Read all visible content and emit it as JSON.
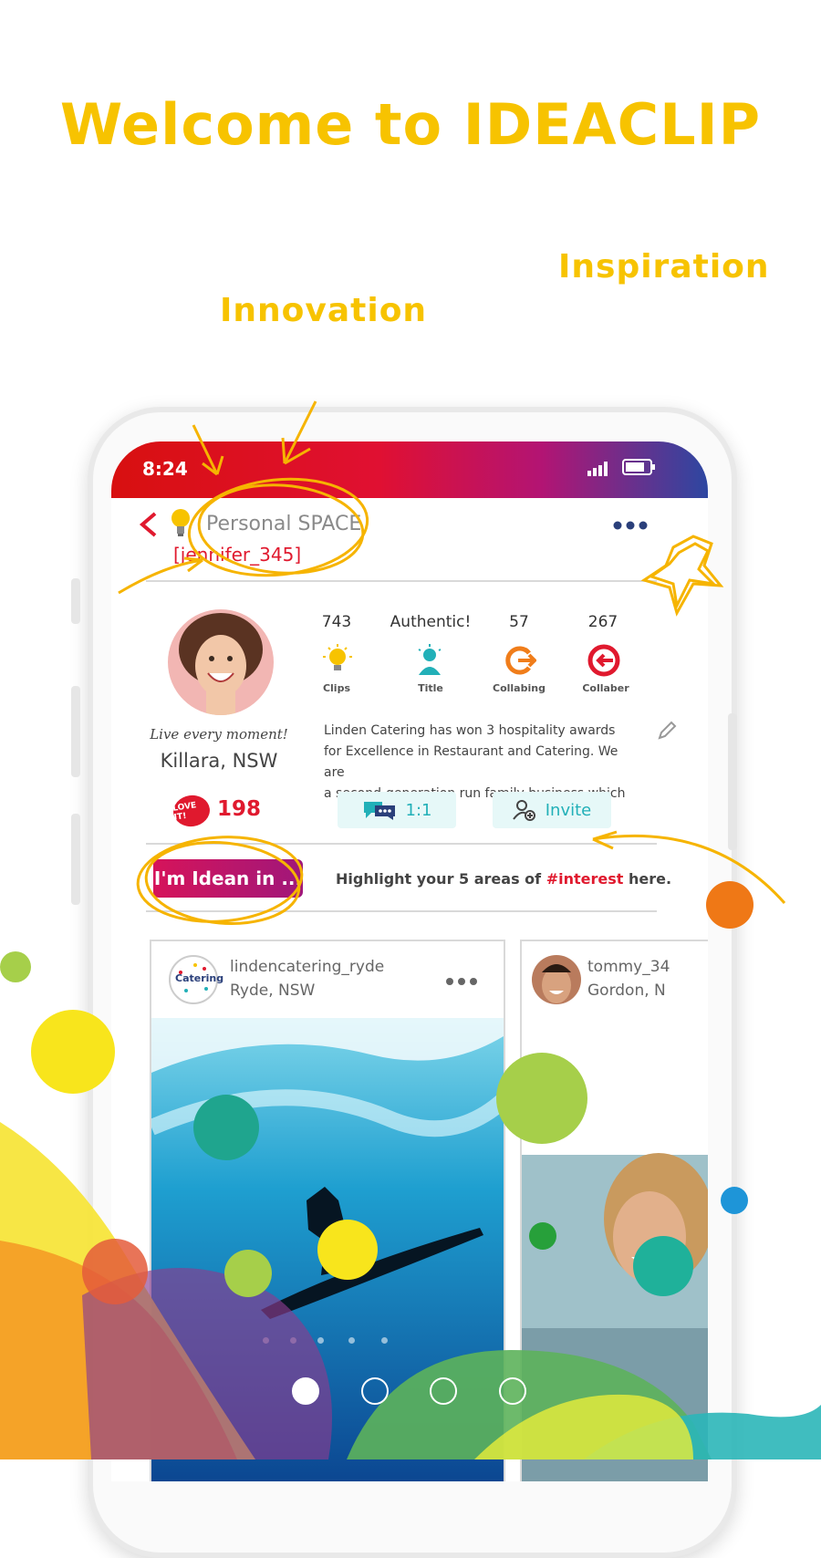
{
  "headline": "Welcome to IDEACLIP",
  "taglines": {
    "inspiration": "Inspiration",
    "innovation": "Innovation"
  },
  "colors": {
    "brand_yellow": "#f7c300",
    "accent_red": "#e0192e",
    "teal": "#22b0b8"
  },
  "phone": {
    "status": {
      "time": "8:24",
      "signal_icon": "signal-icon",
      "battery_icon": "battery-icon"
    },
    "appbar": {
      "back_icon": "chevron-left-icon",
      "bulb_icon": "lightbulb-icon",
      "title": "Personal SPACE",
      "username": "[jennifer_345]",
      "more_icon": "more-horizontal-icon"
    },
    "profile": {
      "stats": [
        {
          "value": "743",
          "label": "Clips",
          "icon": "lightbulb-icon"
        },
        {
          "value": "Authentic!",
          "label": "Title",
          "icon": "person-icon"
        },
        {
          "value": "57",
          "label": "Collabing",
          "icon": "collab-out-icon"
        },
        {
          "value": "267",
          "label": "Collaber",
          "icon": "collab-in-icon"
        }
      ],
      "motto": "Live every moment!",
      "location": "Killara, NSW",
      "bio_lines": [
        "Linden Catering has won 3 hospitality awards",
        "for Excellence in Restaurant and Catering. We are",
        "a second-generation run family business which"
      ],
      "likes_badge": "LOVE IT!",
      "likes_count": "198",
      "chat_label": "1:1",
      "invite_label": "Invite"
    },
    "interest": {
      "button_label": "I'm Idean in ...",
      "text_prefix": "Highlight your 5 areas of ",
      "hashtag": "#interest",
      "text_suffix": " here."
    },
    "posts": [
      {
        "avatar_text": "Catering",
        "user": "lindencatering_ryde",
        "location": "Ryde, NSW"
      },
      {
        "user": "tommy_34",
        "location": "Gordon, N"
      }
    ]
  },
  "pagination": {
    "active_index": 0,
    "total": 4
  }
}
